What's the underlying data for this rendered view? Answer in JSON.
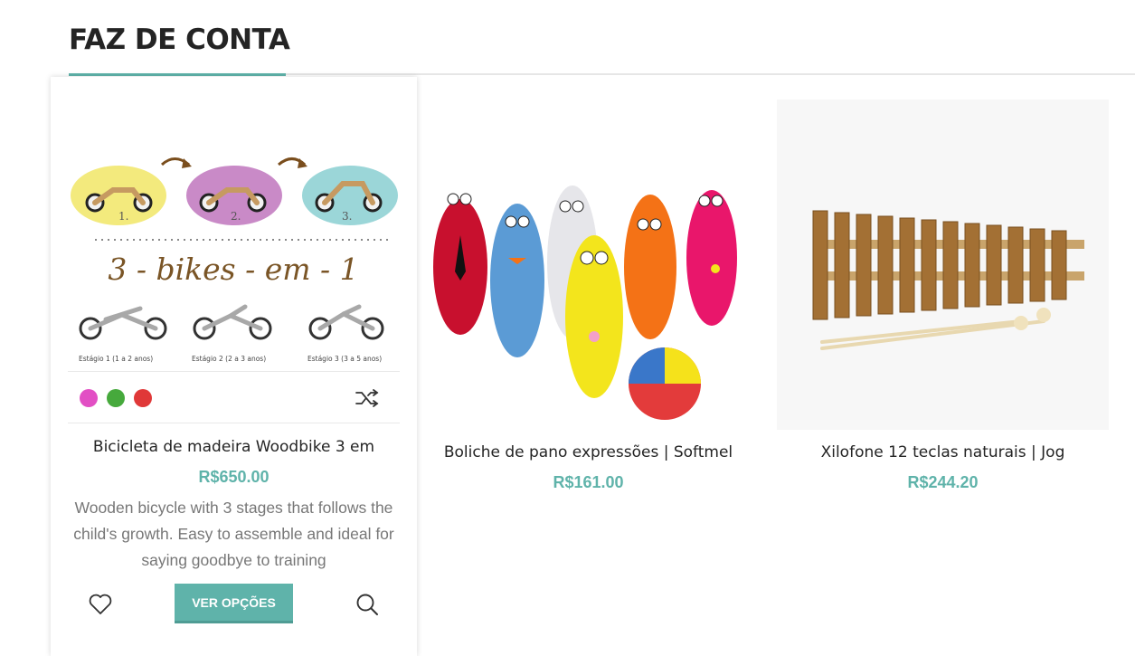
{
  "section": {
    "title": "FAZ DE CONTA"
  },
  "products": [
    {
      "name": "Bicicleta de madeira Woodbike 3 em",
      "price": "R$650.00",
      "description": "Wooden bicycle with 3 stages that follows the child's growth. Easy to assemble and ideal for saying goodbye to training",
      "image_text": {
        "step1": "1.",
        "step2": "2.",
        "step3": "3.",
        "headline": "3 - bikes - em - 1",
        "stage1": "Estágio 1  (1 a 2 anos)",
        "stage2": "Estágio 2  (2 a 3 anos)",
        "stage3": "Estágio 3  (3 a 5 anos)"
      },
      "swatches": [
        "#e24fc4",
        "#46a93c",
        "#e03838"
      ],
      "button_label": "VER OPÇÕES",
      "icons": {
        "wishlist": "heart-icon",
        "compare": "shuffle-icon",
        "quickview": "search-icon"
      }
    },
    {
      "name": "Boliche de pano expressões | Softmel",
      "price": "R$161.00"
    },
    {
      "name": "Xilofone 12 teclas naturais | Jog",
      "price": "R$244.20"
    }
  ],
  "colors": {
    "accent": "#5fb3aa",
    "text": "#242424",
    "muted": "#777777"
  }
}
